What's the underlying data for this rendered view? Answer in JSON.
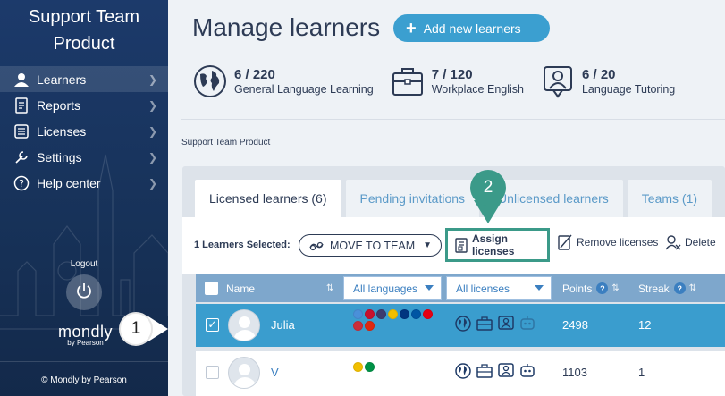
{
  "sidebar": {
    "brand_line1": "Support Team",
    "brand_line2": "Product",
    "items": [
      {
        "label": "Learners",
        "icon": "person-icon",
        "active": true
      },
      {
        "label": "Reports",
        "icon": "report-icon"
      },
      {
        "label": "Licenses",
        "icon": "list-icon"
      },
      {
        "label": "Settings",
        "icon": "wrench-icon"
      },
      {
        "label": "Help center",
        "icon": "question-icon"
      }
    ],
    "logout_label": "Logout",
    "logo_text": "mondly",
    "logo_sub": "by Pearson",
    "copyright": "© Mondly by Pearson"
  },
  "callouts": {
    "one": "1",
    "two": "2"
  },
  "header": {
    "title": "Manage learners",
    "add_button": "Add new learners"
  },
  "stats": [
    {
      "count": "6 / 220",
      "label": "General Language Learning",
      "icon": "globe-icon"
    },
    {
      "count": "7 / 120",
      "label": "Workplace English",
      "icon": "briefcase-icon"
    },
    {
      "count": "6 / 20",
      "label": "Language Tutoring",
      "icon": "tutor-icon"
    }
  ],
  "breadcrumb": "Support Team Product",
  "tabs": [
    {
      "label": "Licensed learners (6)",
      "active": true
    },
    {
      "label": "Pending invitations"
    },
    {
      "label": "Unlicensed learners"
    },
    {
      "label": "Teams (1)"
    }
  ],
  "toolbar": {
    "selected_text": "1 Learners Selected:",
    "move_label": "MOVE TO TEAM",
    "assign_label": "Assign licenses",
    "remove_label": "Remove licenses",
    "delete_label": "Delete"
  },
  "table": {
    "col_name": "Name",
    "filter_languages": "All languages",
    "filter_licenses": "All licenses",
    "col_points": "Points",
    "col_streak": "Streak",
    "rows": [
      {
        "name": "Julia",
        "points": "2498",
        "streak": "12",
        "selected": true,
        "flags": [
          "#4a90d9",
          "#c8102e",
          "#3c3b6e",
          "#f1bf00",
          "#003580",
          "#0055a4",
          "#e60012",
          "#cd2e3a",
          "#de2910"
        ]
      },
      {
        "name": "V",
        "points": "1103",
        "streak": "1",
        "selected": false,
        "flags": [
          "#f1bf00",
          "#009246"
        ]
      }
    ]
  },
  "colors": {
    "accent": "#3b9fd0",
    "highlight": "#3b9a89",
    "sidebar": "#1c3a6b",
    "selected_row": "#3a9dce"
  }
}
